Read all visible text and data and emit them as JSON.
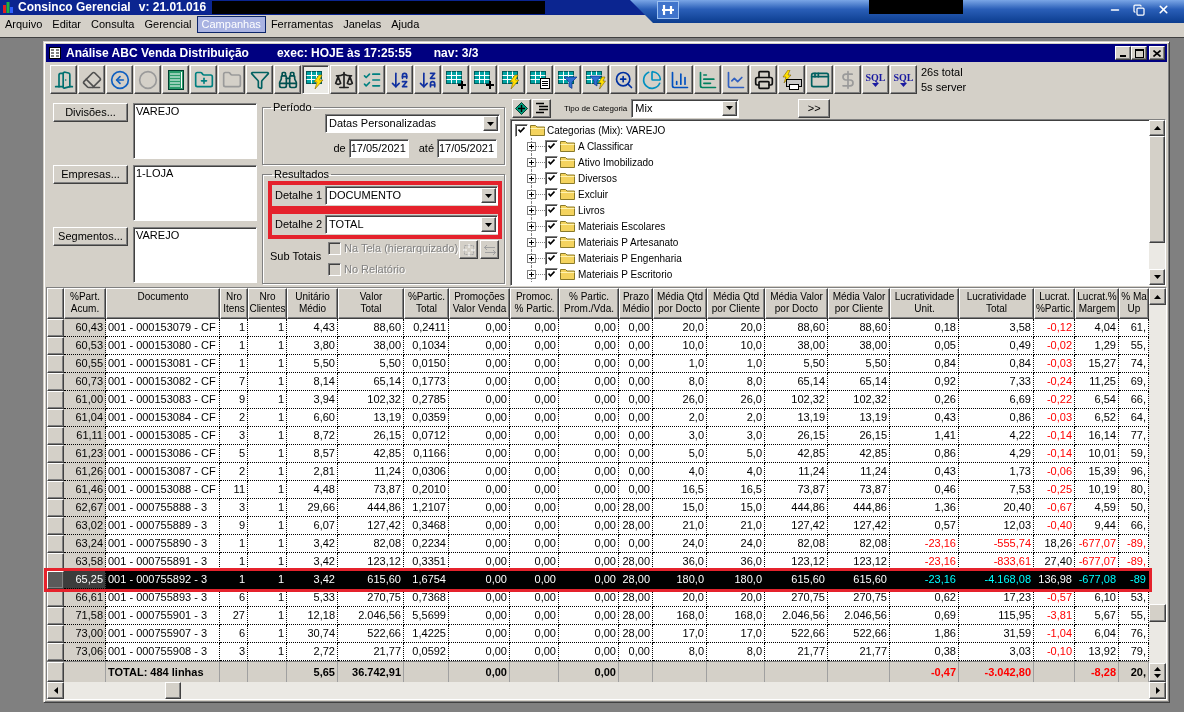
{
  "app_title": {
    "name": "Consinco Gerencial",
    "version": "v: 21.01.016"
  },
  "menu": [
    {
      "label": "Arquivo",
      "selected": false
    },
    {
      "label": "Editar",
      "selected": false
    },
    {
      "label": "Consulta",
      "selected": false
    },
    {
      "label": "Gerencial",
      "selected": false
    },
    {
      "label": "Campanhas",
      "selected": true
    },
    {
      "label": "Ferramentas",
      "selected": false
    },
    {
      "label": "Janelas",
      "selected": false
    },
    {
      "label": "Ajuda",
      "selected": false
    }
  ],
  "window": {
    "title": "Análise ABC Venda Distribuição",
    "exec": "exec: HOJE às 17:25:55",
    "nav": "nav: 3/3"
  },
  "toolbar": [
    {
      "pressed": false,
      "disabled": false
    },
    {
      "pressed": false,
      "disabled": false
    },
    {
      "pressed": false,
      "disabled": false
    },
    {
      "pressed": false,
      "disabled": true
    },
    {
      "pressed": false,
      "disabled": false
    },
    {
      "pressed": false,
      "disabled": false
    },
    {
      "pressed": false,
      "disabled": true
    },
    {
      "pressed": false,
      "disabled": false
    },
    {
      "pressed": false,
      "disabled": false
    },
    {
      "pressed": true,
      "disabled": false
    },
    {
      "pressed": false,
      "disabled": false
    },
    {
      "pressed": false,
      "disabled": false
    },
    {
      "pressed": false,
      "disabled": false
    },
    {
      "pressed": false,
      "disabled": false
    },
    {
      "pressed": false,
      "disabled": false
    },
    {
      "pressed": false,
      "disabled": false
    },
    {
      "pressed": false,
      "disabled": false
    },
    {
      "pressed": false,
      "disabled": false
    },
    {
      "pressed": false,
      "disabled": false
    },
    {
      "pressed": false,
      "disabled": false
    },
    {
      "pressed": false,
      "disabled": false
    },
    {
      "pressed": false,
      "disabled": false
    },
    {
      "pressed": false,
      "disabled": false
    },
    {
      "pressed": false,
      "disabled": false
    },
    {
      "pressed": false,
      "disabled": false
    },
    {
      "pressed": false,
      "disabled": false
    },
    {
      "pressed": false,
      "disabled": false
    },
    {
      "pressed": false,
      "disabled": false
    },
    {
      "pressed": false,
      "disabled": true
    },
    {
      "label": "SQL",
      "pressed": false,
      "disabled": false
    },
    {
      "label": "SQL",
      "pressed": false,
      "disabled": false
    }
  ],
  "timing": [
    "26s total",
    "5s server"
  ],
  "selectors": [
    {
      "button": "Divisões...",
      "value": "VAREJO"
    },
    {
      "button": "Empresas...",
      "value": "1-LOJA"
    },
    {
      "button": "Segmentos...",
      "value": "VAREJO"
    }
  ],
  "periodo": {
    "title": "Período",
    "mode": "Datas Personalizadas",
    "from_label": "de",
    "from": "17/05/2021",
    "to_label": "até",
    "to": "17/05/2021"
  },
  "resultados": {
    "title": "Resultados",
    "details": [
      {
        "label": "Detalhe 1",
        "value": "DOCUMENTO",
        "highlighted": true
      },
      {
        "label": "Detalhe 2",
        "value": "TOTAL",
        "highlighted": true
      }
    ],
    "subtotals_label": "Sub Totais",
    "subtotals": [
      {
        "label": "Na Tela (hierarquizado)",
        "checked": false,
        "disabled": true
      },
      {
        "label": "No Relatório",
        "checked": false,
        "disabled": true
      }
    ],
    "subtotal_buttons": [
      {
        "disabled": true
      },
      {
        "disabled": true
      }
    ]
  },
  "categories": {
    "type_label": "Tipo de Categoria",
    "type_value": "Mix",
    "more": ">>",
    "tree": {
      "label": "Categorias (Mix): VAREJO",
      "checked": true,
      "children": [
        {
          "label": "A Classificar",
          "checked": true,
          "expanded": false
        },
        {
          "label": "Ativo Imobilizado",
          "checked": true,
          "expanded": false
        },
        {
          "label": "Diversos",
          "checked": true,
          "expanded": false
        },
        {
          "label": "Excluir",
          "checked": true,
          "expanded": false
        },
        {
          "label": "Livros",
          "checked": true,
          "expanded": false
        },
        {
          "label": "Materiais Escolares",
          "checked": true,
          "expanded": false
        },
        {
          "label": "Materiais P Artesanato",
          "checked": true,
          "expanded": false
        },
        {
          "label": "Materiais P Engenharia",
          "checked": true,
          "expanded": false
        },
        {
          "label": "Materiais P Escritorio",
          "checked": true,
          "expanded": false
        }
      ]
    }
  },
  "table": {
    "columns": [
      {
        "lines": [
          "%Part.",
          "Acum."
        ]
      },
      {
        "lines": [
          "Documento"
        ]
      },
      {
        "lines": [
          "Nro",
          "Itens"
        ]
      },
      {
        "lines": [
          "Nro",
          "Clientes"
        ]
      },
      {
        "lines": [
          "Unitário",
          "Médio"
        ]
      },
      {
        "lines": [
          "Valor",
          "Total"
        ]
      },
      {
        "lines": [
          "%Partic.",
          "Total"
        ]
      },
      {
        "lines": [
          "Promoções",
          "Valor Venda"
        ]
      },
      {
        "lines": [
          "Promoc.",
          "% Partic."
        ]
      },
      {
        "lines": [
          "% Partic.",
          "Prom./Vda."
        ]
      },
      {
        "lines": [
          "Prazo",
          "Médio"
        ]
      },
      {
        "lines": [
          "Média Qtd",
          "por Docto"
        ]
      },
      {
        "lines": [
          "Média Qtd",
          "por Cliente"
        ]
      },
      {
        "lines": [
          "Média Valor",
          "por Docto"
        ]
      },
      {
        "lines": [
          "Média Valor",
          "por Cliente"
        ]
      },
      {
        "lines": [
          "Lucratividade",
          "Unit."
        ]
      },
      {
        "lines": [
          "Lucratividade",
          "Total"
        ]
      },
      {
        "lines": [
          "Lucrat.",
          "%Partic."
        ]
      },
      {
        "lines": [
          "Lucrat.%",
          "Margem"
        ]
      },
      {
        "lines": [
          "% Ma",
          "Up"
        ]
      }
    ],
    "rows": [
      {
        "selected": false,
        "highlighted": false,
        "cells": [
          "60,43",
          "001 - 000153079 - CF",
          "1",
          "1",
          "4,43",
          "88,60",
          "0,2411",
          "0,00",
          "0,00",
          "0,00",
          "0,00",
          "20,0",
          "20,0",
          "88,60",
          "88,60",
          "0,18",
          "3,58",
          {
            "text": "-0,12",
            "negative": true
          },
          "4,04",
          "61,"
        ]
      },
      {
        "selected": false,
        "highlighted": false,
        "cells": [
          "60,53",
          "001 - 000153080 - CF",
          "1",
          "1",
          "3,80",
          "38,00",
          "0,1034",
          "0,00",
          "0,00",
          "0,00",
          "0,00",
          "10,0",
          "10,0",
          "38,00",
          "38,00",
          "0,05",
          "0,49",
          {
            "text": "-0,02",
            "negative": true
          },
          "1,29",
          "55,"
        ]
      },
      {
        "selected": false,
        "highlighted": false,
        "cells": [
          "60,55",
          "001 - 000153081 - CF",
          "1",
          "1",
          "5,50",
          "5,50",
          "0,0150",
          "0,00",
          "0,00",
          "0,00",
          "0,00",
          "1,0",
          "1,0",
          "5,50",
          "5,50",
          "0,84",
          "0,84",
          {
            "text": "-0,03",
            "negative": true
          },
          "15,27",
          "74,"
        ]
      },
      {
        "selected": false,
        "highlighted": false,
        "cells": [
          "60,73",
          "001 - 000153082 - CF",
          "7",
          "1",
          "8,14",
          "65,14",
          "0,1773",
          "0,00",
          "0,00",
          "0,00",
          "0,00",
          "8,0",
          "8,0",
          "65,14",
          "65,14",
          "0,92",
          "7,33",
          {
            "text": "-0,24",
            "negative": true
          },
          "11,25",
          "69,"
        ]
      },
      {
        "selected": false,
        "highlighted": false,
        "cells": [
          "61,00",
          "001 - 000153083 - CF",
          "9",
          "1",
          "3,94",
          "102,32",
          "0,2785",
          "0,00",
          "0,00",
          "0,00",
          "0,00",
          "26,0",
          "26,0",
          "102,32",
          "102,32",
          "0,26",
          "6,69",
          {
            "text": "-0,22",
            "negative": true
          },
          "6,54",
          "66,"
        ]
      },
      {
        "selected": false,
        "highlighted": false,
        "cells": [
          "61,04",
          "001 - 000153084 - CF",
          "2",
          "1",
          "6,60",
          "13,19",
          "0,0359",
          "0,00",
          "0,00",
          "0,00",
          "0,00",
          "2,0",
          "2,0",
          "13,19",
          "13,19",
          "0,43",
          "0,86",
          {
            "text": "-0,03",
            "negative": true
          },
          "6,52",
          "64,"
        ]
      },
      {
        "selected": false,
        "highlighted": false,
        "cells": [
          "61,11",
          "001 - 000153085 - CF",
          "3",
          "1",
          "8,72",
          "26,15",
          "0,0712",
          "0,00",
          "0,00",
          "0,00",
          "0,00",
          "3,0",
          "3,0",
          "26,15",
          "26,15",
          "1,41",
          "4,22",
          {
            "text": "-0,14",
            "negative": true
          },
          "16,14",
          "77,"
        ]
      },
      {
        "selected": false,
        "highlighted": false,
        "cells": [
          "61,23",
          "001 - 000153086 - CF",
          "5",
          "1",
          "8,57",
          "42,85",
          "0,1166",
          "0,00",
          "0,00",
          "0,00",
          "0,00",
          "5,0",
          "5,0",
          "42,85",
          "42,85",
          "0,86",
          "4,29",
          {
            "text": "-0,14",
            "negative": true
          },
          "10,01",
          "59,"
        ]
      },
      {
        "selected": false,
        "highlighted": false,
        "cells": [
          "61,26",
          "001 - 000153087 - CF",
          "2",
          "1",
          "2,81",
          "11,24",
          "0,0306",
          "0,00",
          "0,00",
          "0,00",
          "0,00",
          "4,0",
          "4,0",
          "11,24",
          "11,24",
          "0,43",
          "1,73",
          {
            "text": "-0,06",
            "negative": true
          },
          "15,39",
          "96,"
        ]
      },
      {
        "selected": false,
        "highlighted": false,
        "cells": [
          "61,46",
          "001 - 000153088 - CF",
          "11",
          "1",
          "4,48",
          "73,87",
          "0,2010",
          "0,00",
          "0,00",
          "0,00",
          "0,00",
          "16,5",
          "16,5",
          "73,87",
          "73,87",
          "0,46",
          "7,53",
          {
            "text": "-0,25",
            "negative": true
          },
          "10,19",
          "80,"
        ]
      },
      {
        "selected": false,
        "highlighted": false,
        "cells": [
          "62,67",
          "001 - 000755888 - 3",
          "3",
          "1",
          "29,66",
          "444,86",
          "1,2107",
          "0,00",
          "0,00",
          "0,00",
          "28,00",
          "15,0",
          "15,0",
          "444,86",
          "444,86",
          "1,36",
          "20,40",
          {
            "text": "-0,67",
            "negative": true
          },
          "4,59",
          "50,"
        ]
      },
      {
        "selected": false,
        "highlighted": false,
        "cells": [
          "63,02",
          "001 - 000755889 - 3",
          "9",
          "1",
          "6,07",
          "127,42",
          "0,3468",
          "0,00",
          "0,00",
          "0,00",
          "28,00",
          "21,0",
          "21,0",
          "127,42",
          "127,42",
          "0,57",
          "12,03",
          {
            "text": "-0,40",
            "negative": true
          },
          "9,44",
          "66,"
        ]
      },
      {
        "selected": false,
        "highlighted": false,
        "cells": [
          "63,24",
          "001 - 000755890 - 3",
          "1",
          "1",
          "3,42",
          "82,08",
          "0,2234",
          "0,00",
          "0,00",
          "0,00",
          "0,00",
          "24,0",
          "24,0",
          "82,08",
          "82,08",
          {
            "text": "-23,16",
            "negative": true
          },
          {
            "text": "-555,74",
            "negative": true
          },
          "18,26",
          {
            "text": "-677,07",
            "negative": true
          },
          {
            "text": "-89,",
            "negative": true
          }
        ]
      },
      {
        "selected": false,
        "highlighted": false,
        "cells": [
          "63,58",
          "001 - 000755891 - 3",
          "1",
          "1",
          "3,42",
          "123,12",
          "0,3351",
          "0,00",
          "0,00",
          "0,00",
          "28,00",
          "36,0",
          "36,0",
          "123,12",
          "123,12",
          {
            "text": "-23,16",
            "negative": true
          },
          {
            "text": "-833,61",
            "negative": true
          },
          "27,40",
          {
            "text": "-677,07",
            "negative": true
          },
          {
            "text": "-89,",
            "negative": true
          }
        ]
      },
      {
        "selected": true,
        "highlighted": true,
        "cells": [
          "65,25",
          "001 - 000755892 - 3",
          "1",
          "1",
          "3,42",
          "615,60",
          "1,6754",
          "0,00",
          "0,00",
          "0,00",
          "28,00",
          "180,0",
          "180,0",
          "615,60",
          "615,60",
          {
            "text": "-23,16",
            "negative": true
          },
          {
            "text": "-4.168,08",
            "negative": true
          },
          "136,98",
          {
            "text": "-677,08",
            "negative": true
          },
          {
            "text": "-89",
            "negative": true
          }
        ]
      },
      {
        "selected": false,
        "highlighted": false,
        "cells": [
          "66,61",
          "001 - 000755893 - 3",
          "6",
          "1",
          "5,33",
          "270,75",
          "0,7368",
          "0,00",
          "0,00",
          "0,00",
          "28,00",
          "20,0",
          "20,0",
          "270,75",
          "270,75",
          "0,62",
          "17,23",
          {
            "text": "-0,57",
            "negative": true
          },
          "6,10",
          "53,"
        ]
      },
      {
        "selected": false,
        "highlighted": false,
        "cells": [
          "71,58",
          "001 - 000755901 - 3",
          "27",
          "1",
          "12,18",
          "2.046,56",
          "5,5699",
          "0,00",
          "0,00",
          "0,00",
          "28,00",
          "168,0",
          "168,0",
          "2.046,56",
          "2.046,56",
          "0,69",
          "115,95",
          {
            "text": "-3,81",
            "negative": true
          },
          "5,67",
          "55,"
        ]
      },
      {
        "selected": false,
        "highlighted": false,
        "cells": [
          "73,00",
          "001 - 000755907 - 3",
          "6",
          "1",
          "30,74",
          "522,66",
          "1,4225",
          "0,00",
          "0,00",
          "0,00",
          "28,00",
          "17,0",
          "17,0",
          "522,66",
          "522,66",
          "1,86",
          "31,59",
          {
            "text": "-1,04",
            "negative": true
          },
          "6,04",
          "76,"
        ]
      },
      {
        "selected": false,
        "highlighted": false,
        "cells": [
          "73,06",
          "001 - 000755908 - 3",
          "3",
          "1",
          "2,72",
          "21,77",
          "0,0592",
          "0,00",
          "0,00",
          "0,00",
          "0,00",
          "8,0",
          "8,0",
          "21,77",
          "21,77",
          "0,38",
          "3,03",
          {
            "text": "-0,10",
            "negative": true
          },
          "13,92",
          "79,"
        ]
      }
    ],
    "total": {
      "documento": "TOTAL: 484 linhas",
      "unitario_medio": "5,65",
      "valor_total": "36.742,91",
      "promocoes_valor_venda": "0,00",
      "partic_prom_vda": "0,00",
      "lucratividade_unit": {
        "text": "-0,47",
        "negative": true
      },
      "lucratividade_total": {
        "text": "-3.042,80",
        "negative": true
      },
      "lucrat_margem": {
        "text": "-8,28",
        "negative": true
      },
      "column_20": "20,"
    }
  }
}
